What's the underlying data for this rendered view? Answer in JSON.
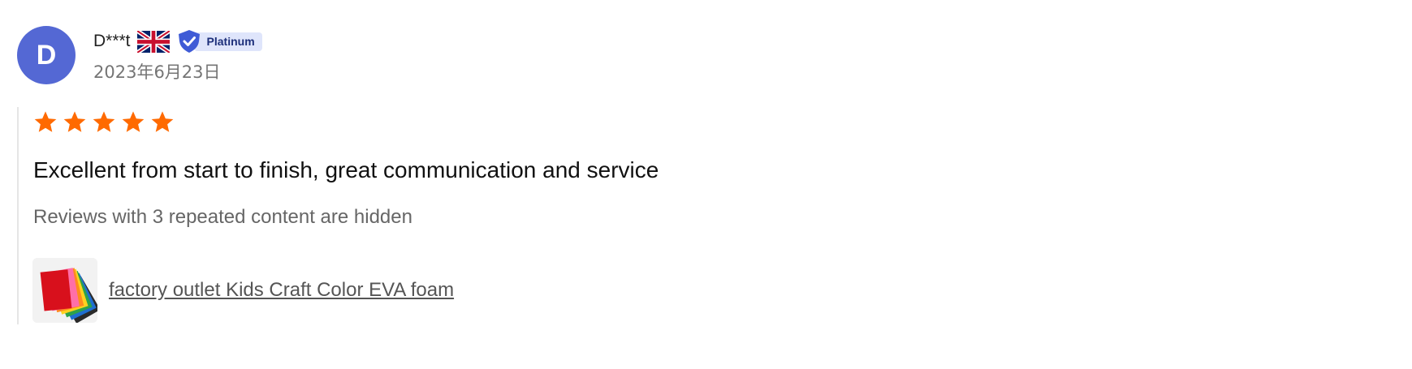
{
  "review": {
    "avatar_letter": "D",
    "avatar_color": "#5468d4",
    "username": "D***t",
    "country_flag_icon": "uk-flag-icon",
    "badge_label": "Platinum",
    "badge_icon": "verified-shield-icon",
    "date": "2023年6月23日",
    "rating": 5,
    "rating_max": 5,
    "star_color": "#ff6a00",
    "comment": "Excellent from start to finish, great communication and service",
    "hidden_note": "Reviews with 3 repeated content are hidden",
    "product": {
      "thumbnail_icon": "product-thumbnail",
      "title": "factory outlet Kids Craft Color EVA foam"
    }
  }
}
